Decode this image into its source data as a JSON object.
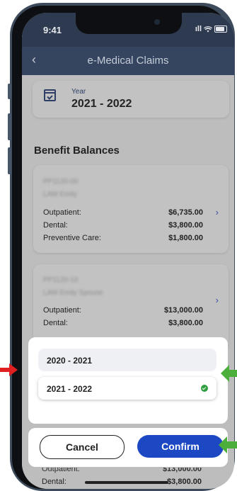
{
  "status_bar": {
    "time": "9:41",
    "signal": "ıll"
  },
  "nav": {
    "back": "‹",
    "title": "e-Medical Claims"
  },
  "year_selector": {
    "label": "Year",
    "value": "2021 - 2022"
  },
  "section_title": "Benefit Balances",
  "benefit_cards": [
    {
      "member_id": "PP1120-00",
      "member_name": "LAM Emily",
      "rows": [
        {
          "label": "Outpatient:",
          "amount": "$6,735.00"
        },
        {
          "label": "Dental:",
          "amount": "$3,800.00"
        },
        {
          "label": "Preventive Care:",
          "amount": "$1,800.00"
        }
      ]
    },
    {
      "member_id": "PP1120-10",
      "member_name": "LAM Emily Spouse",
      "rows": [
        {
          "label": "Outpatient:",
          "amount": "$13,000.00"
        },
        {
          "label": "Dental:",
          "amount": "$3,800.00"
        }
      ]
    }
  ],
  "picker": {
    "options": [
      "2020 - 2021",
      "2021 - 2022"
    ],
    "selected": "2021 - 2022"
  },
  "actions": {
    "cancel": "Cancel",
    "confirm": "Confirm"
  },
  "background_peek": {
    "rows": [
      {
        "label": "Outpatient:",
        "amount": "$13,000.00"
      },
      {
        "label": "Dental:",
        "amount": "$3,800.00"
      }
    ]
  },
  "colors": {
    "annotation_red": "#e02020",
    "annotation_green": "#4caf3c",
    "confirm_blue": "#1c48c4",
    "check_green": "#2e9e3e"
  }
}
